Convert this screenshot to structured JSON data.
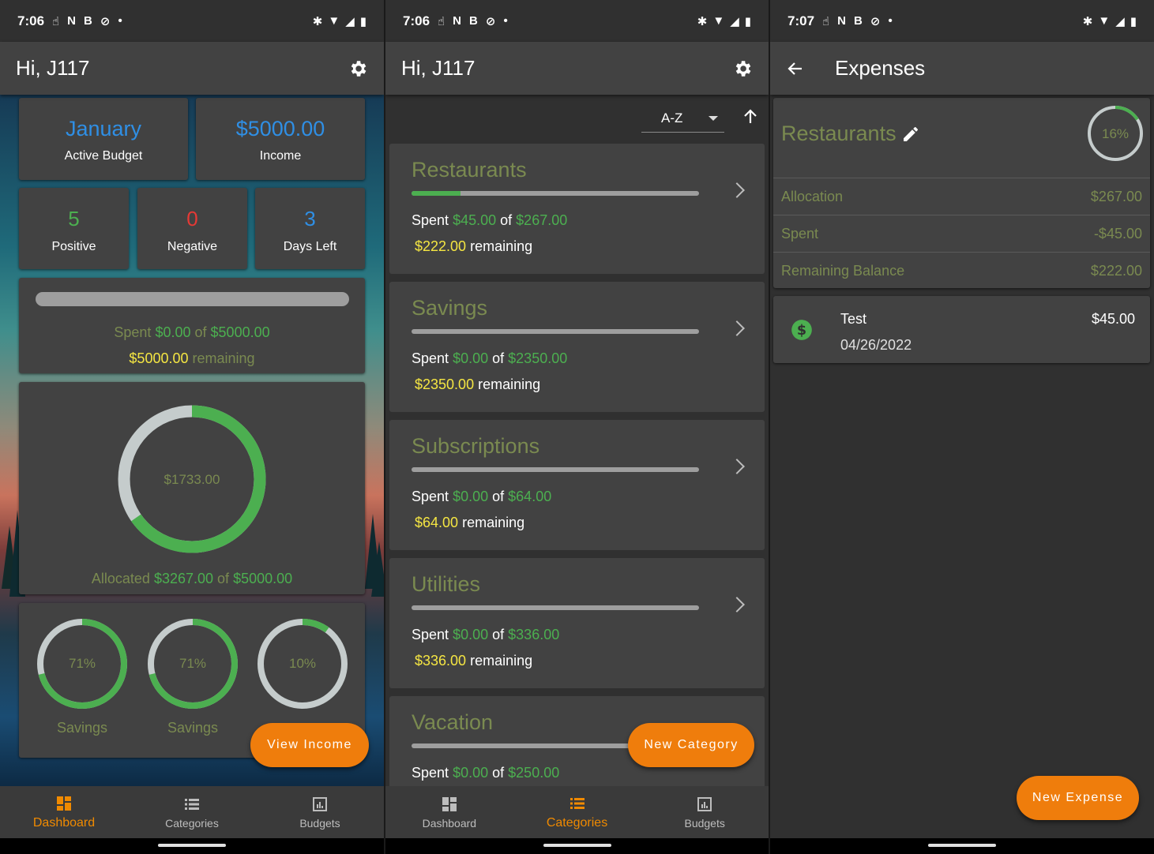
{
  "colors": {
    "accent": "#ef7d0c",
    "positive": "#4caf50",
    "negative": "#e53935",
    "highlight": "#f5e642",
    "info": "#2f8fe5",
    "muted_olive": "#7a8a50"
  },
  "screens": [
    {
      "status": {
        "time": "7:06",
        "icons": [
          "hand-icon",
          "n-icon",
          "b-icon",
          "sync-icon",
          "dot"
        ],
        "right_icons": [
          "bluetooth-icon",
          "wifi-icon",
          "signal-icon",
          "battery-icon"
        ]
      },
      "appbar": {
        "title": "Hi, J117"
      },
      "summary": {
        "month": "January",
        "month_label": "Active Budget",
        "income": "$5000.00",
        "income_label": "Income",
        "positive": "5",
        "positive_label": "Positive",
        "negative": "0",
        "negative_label": "Negative",
        "days_left": "3",
        "days_left_label": "Days Left"
      },
      "spent_card": {
        "spent_prefix": "Spent",
        "spent": "$0.00",
        "of": "of",
        "total": "$5000.00",
        "remaining_amount": "$5000.00",
        "remaining_label": "remaining",
        "progress": 0
      },
      "allocation_card": {
        "center": "$1733.00",
        "prefix": "Allocated",
        "allocated": "$3267.00",
        "of": "of",
        "total": "$5000.00",
        "allocated_fraction": 0.6534
      },
      "mini_rings": [
        {
          "percent": "71%",
          "label": "Savings",
          "fraction": 0.71
        },
        {
          "percent": "71%",
          "label": "Savings",
          "fraction": 0.71
        },
        {
          "percent": "10%",
          "label": "",
          "fraction": 0.1
        }
      ],
      "fab": "View Income",
      "nav": {
        "dashboard": "Dashboard",
        "categories": "Categories",
        "budgets": "Budgets",
        "active": "dashboard"
      }
    },
    {
      "status": {
        "time": "7:06"
      },
      "appbar": {
        "title": "Hi, J117"
      },
      "sort": {
        "value": "A-Z"
      },
      "categories": [
        {
          "name": "Restaurants",
          "spent": "$45.00",
          "total": "$267.00",
          "remaining": "$222.00",
          "progress": 0.17
        },
        {
          "name": "Savings",
          "spent": "$0.00",
          "total": "$2350.00",
          "remaining": "$2350.00",
          "progress": 0
        },
        {
          "name": "Subscriptions",
          "spent": "$0.00",
          "total": "$64.00",
          "remaining": "$64.00",
          "progress": 0
        },
        {
          "name": "Utilities",
          "spent": "$0.00",
          "total": "$336.00",
          "remaining": "$336.00",
          "progress": 0
        },
        {
          "name": "Vacation",
          "spent": "$0.00",
          "total": "$250.00",
          "remaining": "",
          "progress": 0
        }
      ],
      "text": {
        "spent": "Spent",
        "of": "of",
        "remaining": "remaining"
      },
      "fab": "New Category",
      "nav": {
        "dashboard": "Dashboard",
        "categories": "Categories",
        "budgets": "Budgets",
        "active": "categories"
      }
    },
    {
      "status": {
        "time": "7:07"
      },
      "appbar": {
        "title": "Expenses"
      },
      "category": {
        "name": "Restaurants",
        "percent": "16%",
        "fraction": 0.16
      },
      "rows": [
        {
          "label": "Allocation",
          "value": "$267.00"
        },
        {
          "label": "Spent",
          "value": "-$45.00"
        },
        {
          "label": "Remaining Balance",
          "value": "$222.00"
        }
      ],
      "expense": {
        "name": "Test",
        "amount": "$45.00",
        "date": "04/26/2022"
      },
      "fab": "New Expense"
    }
  ]
}
